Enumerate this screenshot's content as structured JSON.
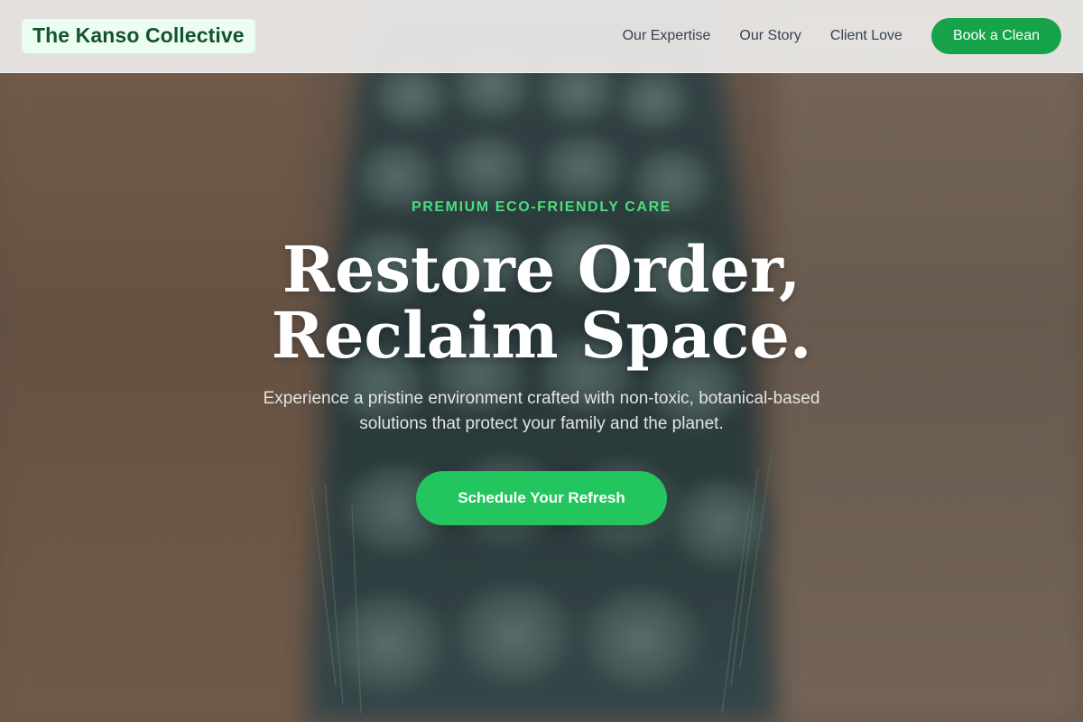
{
  "header": {
    "brand": "The Kanso Collective",
    "nav": [
      "Our Expertise",
      "Our Story",
      "Client Love"
    ],
    "book_label": "Book a Clean"
  },
  "hero": {
    "eyebrow": "PREMIUM ECO-FRIENDLY CARE",
    "headline_line1": "Restore Order,",
    "headline_line2": "Reclaim Space.",
    "subtext": "Experience a pristine environment crafted with non-toxic, botanical-based solutions that protect your family and the planet.",
    "cta_label": "Schedule Your Refresh",
    "background_image": "cleaning-brush-bristles-photo"
  },
  "colors": {
    "accent": "#16a34a",
    "cta": "#22c55e",
    "eyebrow": "#4ade80",
    "brand_text": "#14532d",
    "brand_bg": "#ecfdf2",
    "header_bg": "#e8e6e4"
  }
}
